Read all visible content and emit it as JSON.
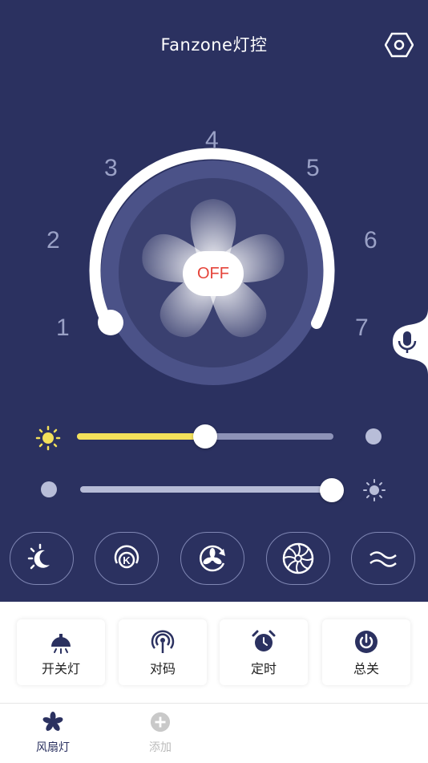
{
  "header": {
    "title": "Fanzone灯控",
    "settings_icon": "settings-hexagon-icon"
  },
  "dial": {
    "ticks": [
      "1",
      "2",
      "3",
      "4",
      "5",
      "6",
      "7"
    ],
    "state_label": "OFF",
    "speed_level": 1
  },
  "voice": {
    "icon": "microphone-icon"
  },
  "sliders": {
    "brightness": {
      "value_fraction": 0.5,
      "left_icon": "sun-icon",
      "right_icon": "dim-dot-icon"
    },
    "color_temp": {
      "value_fraction": 1.0,
      "left_icon": "dim-dot-icon",
      "right_icon": "sun-outline-icon"
    }
  },
  "modes": [
    {
      "name": "day-night-mode",
      "icon": "sun-moon-icon"
    },
    {
      "name": "k-mode",
      "icon": "k-cycle-icon"
    },
    {
      "name": "fan-rotate-mode",
      "icon": "fan-rotate-icon"
    },
    {
      "name": "turbine-mode",
      "icon": "turbine-icon"
    },
    {
      "name": "natural-wind-mode",
      "icon": "wave-icon"
    }
  ],
  "actions": [
    {
      "label": "开关灯",
      "icon": "lamp-icon"
    },
    {
      "label": "对码",
      "icon": "signal-icon"
    },
    {
      "label": "定时",
      "icon": "alarm-clock-icon"
    },
    {
      "label": "总关",
      "icon": "power-icon"
    }
  ],
  "tabs": [
    {
      "label": "风扇灯",
      "icon": "fan-icon",
      "active": true
    },
    {
      "label": "添加",
      "icon": "add-circle-icon",
      "active": false
    }
  ],
  "colors": {
    "background": "#2b3160",
    "accent_yellow": "#f3e05a",
    "off_red": "#e5443a"
  }
}
